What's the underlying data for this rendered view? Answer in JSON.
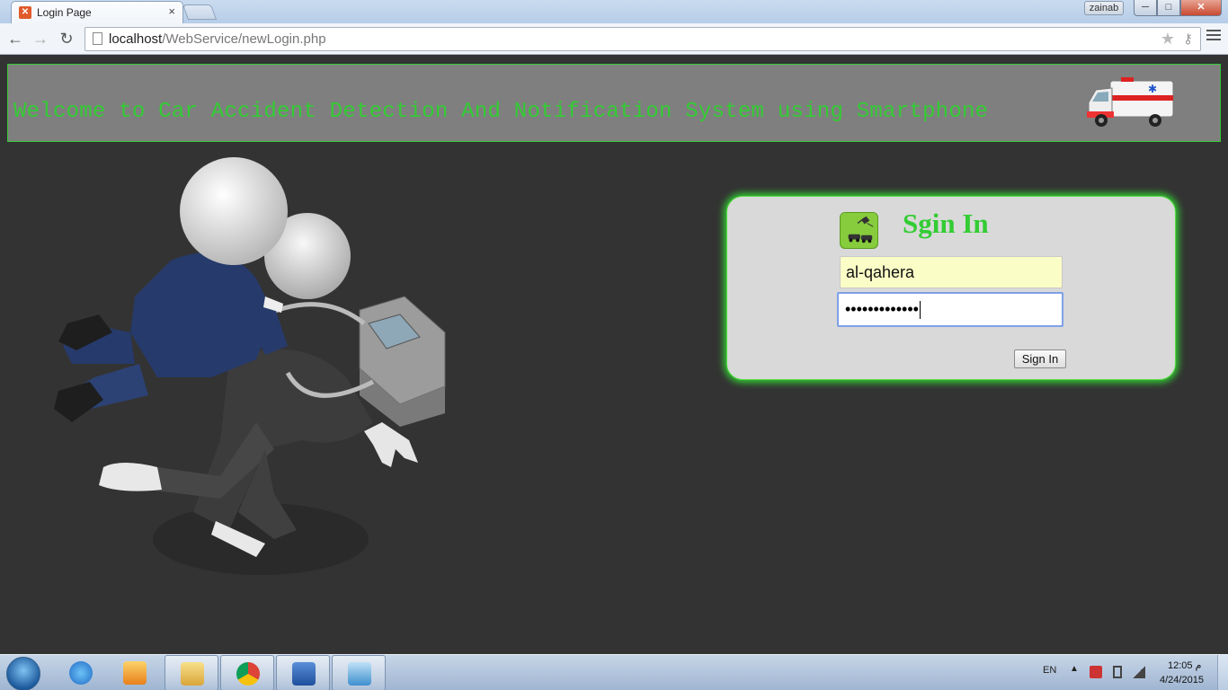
{
  "browser": {
    "tab_title": "Login Page",
    "tab_close": "×",
    "user_badge": "zainab",
    "window_controls": {
      "minimize": "─",
      "maximize": "□",
      "close": "✕"
    },
    "url_host": "localhost",
    "url_path": "/WebService/newLogin.php"
  },
  "header": {
    "welcome_text": "Welcome to Car Accident Detection And Notification System using Smartphone"
  },
  "signin": {
    "heading": "Sgin In",
    "username_value": "al-qahera",
    "password_mask": "•••••••••••••",
    "button_label": "Sign In"
  },
  "taskbar": {
    "language": "EN",
    "tray_arrow": "▲",
    "clock_time": "12:05 م",
    "clock_date": "4/24/2015",
    "pinned": [
      "internet-explorer-icon",
      "media-player-icon",
      "file-explorer-icon",
      "chrome-icon",
      "word-icon",
      "notepad-icon"
    ]
  },
  "colors": {
    "page_background": "#333333",
    "banner_background": "#7f7f7f",
    "accent_green": "#33cc33",
    "panel_background": "#d9d9d9",
    "username_fill": "#fbfdc6"
  }
}
